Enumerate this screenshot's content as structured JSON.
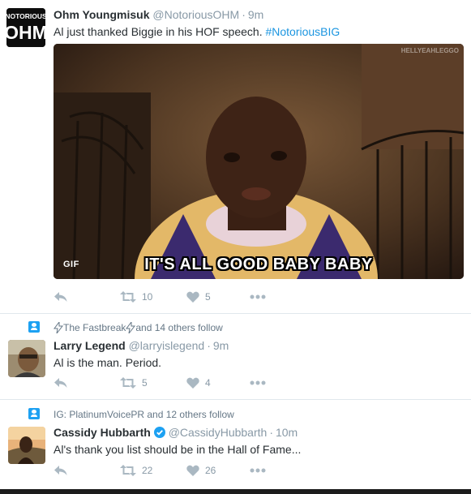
{
  "colors": {
    "link": "#1b95e0",
    "muted": "#8899a6",
    "action_icon": "#aab8c2",
    "context_icon": "#1da1f2",
    "text": "#292f33"
  },
  "tweets": [
    {
      "avatar": {
        "top_text": "NOTORIOUS",
        "bottom_text": "OHM"
      },
      "fullname": "Ohm Youngmisuk",
      "handle": "@NotoriousOHM",
      "time": "9m",
      "text_before": "Al just thanked Biggie in his HOF speech. ",
      "hashtag": "#NotoriousBIG",
      "media": {
        "gif_label": "GIF",
        "caption": "IT'S ALL GOOD BABY BABY",
        "watermark": "HELLYEAHLEGGO"
      },
      "retweets": "10",
      "likes": "5",
      "icons": {
        "reply": "reply-icon",
        "retweet": "retweet-icon",
        "like": "heart-icon",
        "more": "more-icon"
      }
    },
    {
      "context": {
        "prefix": "",
        "names": "The Fastbreak",
        "suffix": " and 14 others follow"
      },
      "fullname": "Larry Legend",
      "handle": "@larryislegend",
      "time": "9m",
      "text": "Al is the man. Period.",
      "retweets": "5",
      "likes": "4",
      "icons": {
        "reply": "reply-icon",
        "retweet": "retweet-icon",
        "like": "heart-icon",
        "more": "more-icon"
      }
    },
    {
      "context": {
        "text": "IG: PlatinumVoicePR and 12 others follow"
      },
      "fullname": "Cassidy Hubbarth",
      "verified": true,
      "handle": "@CassidyHubbarth",
      "time": "10m",
      "text": "Al's thank you list should be in the Hall of Fame...",
      "retweets": "22",
      "likes": "26",
      "icons": {
        "reply": "reply-icon",
        "retweet": "retweet-icon",
        "like": "heart-icon",
        "more": "more-icon"
      }
    }
  ],
  "separator_dot": "·"
}
